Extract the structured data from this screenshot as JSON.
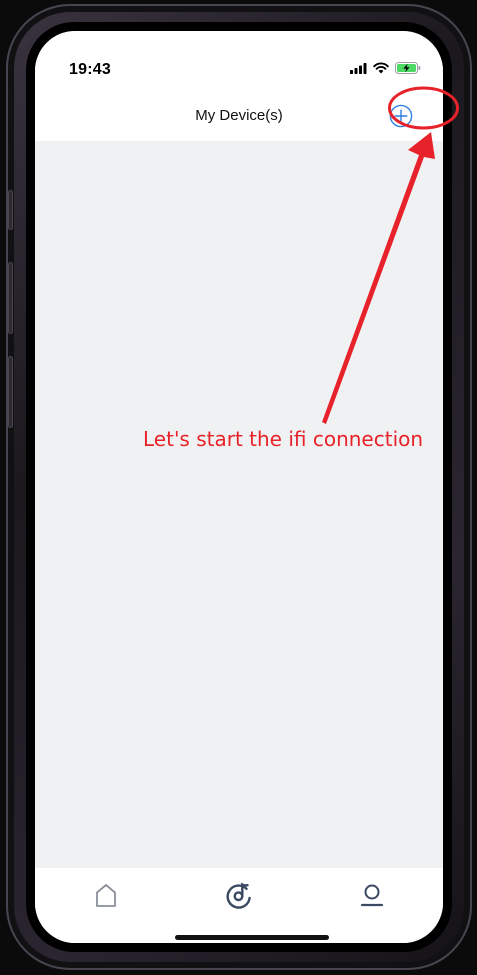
{
  "status_bar": {
    "time": "19:43",
    "signal_icon": "cellular-signal-icon",
    "wifi_icon": "wifi-icon",
    "battery_icon": "battery-charging-icon"
  },
  "nav_bar": {
    "title": "My Device(s)",
    "add_icon": "plus-circle-icon"
  },
  "annotation": {
    "text": "Let's start the ifi connection",
    "color": "#e8222a"
  },
  "tab_bar": {
    "items": [
      {
        "icon": "home-icon"
      },
      {
        "icon": "music-disc-icon"
      },
      {
        "icon": "profile-icon"
      }
    ],
    "accent": "#3b4a63"
  },
  "colors": {
    "accent_blue": "#2f7fe0",
    "background": "#f0f1f3"
  }
}
